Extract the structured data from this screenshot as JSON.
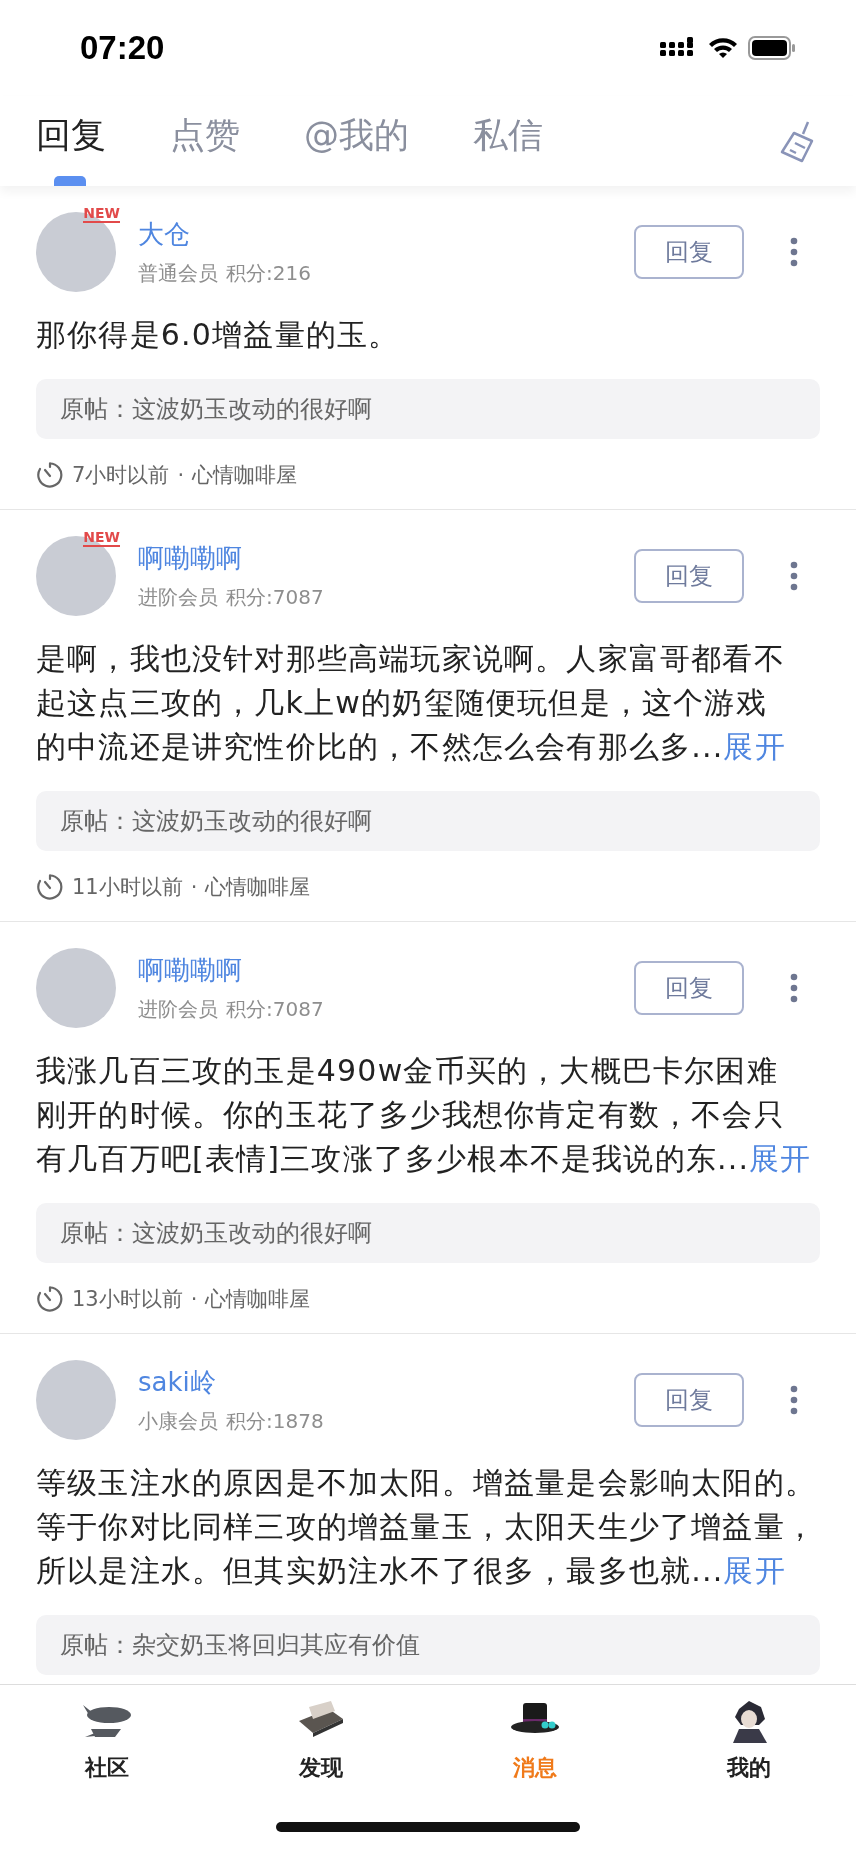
{
  "status_bar": {
    "time": "07:20"
  },
  "tabs": [
    {
      "label": "回复",
      "selected": true
    },
    {
      "label": "点赞",
      "selected": false
    },
    {
      "label": "@我的",
      "selected": false
    },
    {
      "label": "私信",
      "selected": false
    }
  ],
  "posts": [
    {
      "name": "大仓",
      "new_badge": "NEW",
      "member": "普通会员",
      "points": "积分:216",
      "reply_button": "回复",
      "content_lines": [
        "那你得是6.0增益量的玉。"
      ],
      "quote": "原帖：这波奶玉改动的很好啊",
      "time": "7小时以前",
      "separator": "·",
      "board": "心情咖啡屋"
    },
    {
      "name": "啊嘞嘞啊",
      "new_badge": "NEW",
      "member": "进阶会员",
      "points": "积分:7087",
      "reply_button": "回复",
      "content_lines": [
        "是啊，我也没针对那些高端玩家说啊。人家富哥都看不",
        "起这点三攻的，几k上w的奶玺随便玩但是，这个游戏",
        "的中流还是讲究性价比的，不然怎么会有那么多..."
      ],
      "expand": "展开",
      "quote": "原帖：这波奶玉改动的很好啊",
      "time": "11小时以前",
      "separator": "·",
      "board": "心情咖啡屋"
    },
    {
      "name": "啊嘞嘞啊",
      "member": "进阶会员",
      "points": "积分:7087",
      "reply_button": "回复",
      "content_lines": [
        "我涨几百三攻的玉是490w金币买的，大概巴卡尔困难",
        "刚开的时候。你的玉花了多少我想你肯定有数，不会只",
        "有几百万吧[表情]三攻涨了多少根本不是我说的东..."
      ],
      "expand": "展开",
      "quote": "原帖：这波奶玉改动的很好啊",
      "time": "13小时以前",
      "separator": "·",
      "board": "心情咖啡屋"
    },
    {
      "name": "saki岭",
      "member": "小康会员",
      "points": "积分:1878",
      "reply_button": "回复",
      "content_lines": [
        "等级玉注水的原因是不加太阳。增益量是会影响太阳的。",
        "等于你对比同样三攻的增益量玉，太阳天生少了增益量，",
        "所以是注水。但其实奶注水不了很多，最多也就..."
      ],
      "expand": "展开",
      "quote": "原帖：杂交奶玉将回归其应有价值"
    }
  ],
  "bottom_nav": [
    {
      "label": "社区",
      "selected": false
    },
    {
      "label": "发现",
      "selected": false
    },
    {
      "label": "消息",
      "selected": true
    },
    {
      "label": "我的",
      "selected": false
    }
  ]
}
